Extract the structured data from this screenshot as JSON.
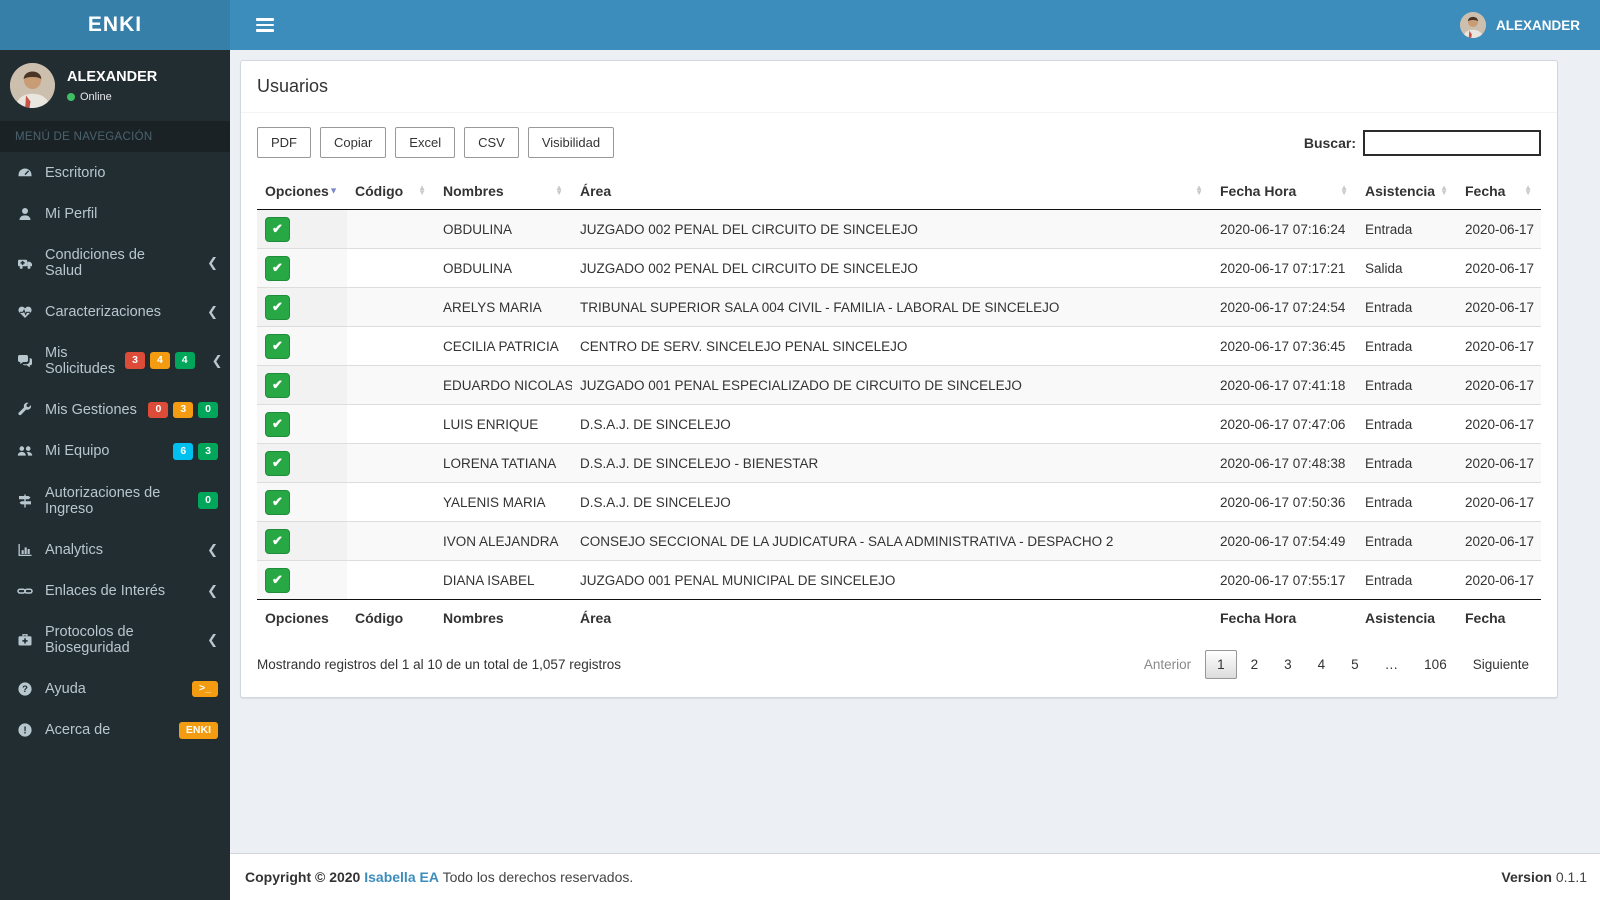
{
  "header": {
    "brand": "ENKI",
    "user_name": "ALEXANDER"
  },
  "sidebar": {
    "profile": {
      "name": "ALEXANDER",
      "status": "Online"
    },
    "nav_header": "MENÚ DE NAVEGACIÓN",
    "items": [
      {
        "icon": "dashboard-icon",
        "label": "Escritorio",
        "badges": [],
        "chevron": false
      },
      {
        "icon": "user-icon",
        "label": "Mi Perfil",
        "badges": [],
        "chevron": false
      },
      {
        "icon": "ambulance-icon",
        "label": "Condiciones de Salud",
        "badges": [],
        "chevron": true
      },
      {
        "icon": "heartbeat-icon",
        "label": "Caracterizaciones",
        "badges": [],
        "chevron": true
      },
      {
        "icon": "comments-icon",
        "label": "Mis Solicitudes",
        "badges": [
          {
            "text": "3",
            "color": "red"
          },
          {
            "text": "4",
            "color": "orange"
          },
          {
            "text": "4",
            "color": "green"
          }
        ],
        "chevron": true
      },
      {
        "icon": "wrench-icon",
        "label": "Mis Gestiones",
        "badges": [
          {
            "text": "0",
            "color": "red"
          },
          {
            "text": "3",
            "color": "orange"
          },
          {
            "text": "0",
            "color": "green"
          }
        ],
        "chevron": false
      },
      {
        "icon": "users-icon",
        "label": "Mi Equipo",
        "badges": [
          {
            "text": "6",
            "color": "cyan"
          },
          {
            "text": "3",
            "color": "green"
          }
        ],
        "chevron": false
      },
      {
        "icon": "map-signs-icon",
        "label": "Autorizaciones de Ingreso",
        "badges": [
          {
            "text": "0",
            "color": "green"
          }
        ],
        "chevron": false
      },
      {
        "icon": "bar-chart-icon",
        "label": "Analytics",
        "badges": [],
        "chevron": true
      },
      {
        "icon": "link-icon",
        "label": "Enlaces de Interés",
        "badges": [],
        "chevron": true
      },
      {
        "icon": "medkit-icon",
        "label": "Protocolos de Bioseguridad",
        "badges": [],
        "chevron": true
      },
      {
        "icon": "question-icon",
        "label": "Ayuda",
        "badges": [
          {
            "text": ">_",
            "color": "orange"
          }
        ],
        "chevron": false
      },
      {
        "icon": "info-icon",
        "label": "Acerca de",
        "badges": [
          {
            "text": "ENKI",
            "color": "orange"
          }
        ],
        "chevron": false
      }
    ]
  },
  "main": {
    "title": "Usuarios",
    "toolbar": {
      "buttons": [
        "PDF",
        "Copiar",
        "Excel",
        "CSV",
        "Visibilidad"
      ],
      "search_label": "Buscar:",
      "search_value": ""
    },
    "table": {
      "columns": [
        "Opciones",
        "Código",
        "Nombres",
        "Área",
        "Fecha Hora",
        "Asistencia",
        "Fecha"
      ],
      "sorted_column": "Opciones",
      "sort_direction": "desc",
      "check_icon": "✔",
      "rows": [
        {
          "codigo": "",
          "nombres": "OBDULINA",
          "area": "JUZGADO 002 PENAL DEL CIRCUITO DE SINCELEJO",
          "fecha_hora": "2020-06-17 07:16:24",
          "asistencia": "Entrada",
          "fecha": "2020-06-17"
        },
        {
          "codigo": "",
          "nombres": "OBDULINA",
          "area": "JUZGADO 002 PENAL DEL CIRCUITO DE SINCELEJO",
          "fecha_hora": "2020-06-17 07:17:21",
          "asistencia": "Salida",
          "fecha": "2020-06-17"
        },
        {
          "codigo": "",
          "nombres": "ARELYS MARIA",
          "area": "TRIBUNAL SUPERIOR SALA 004 CIVIL - FAMILIA - LABORAL DE SINCELEJO",
          "fecha_hora": "2020-06-17 07:24:54",
          "asistencia": "Entrada",
          "fecha": "2020-06-17"
        },
        {
          "codigo": "",
          "nombres": "CECILIA PATRICIA",
          "area": "CENTRO DE SERV. SINCELEJO PENAL SINCELEJO",
          "fecha_hora": "2020-06-17 07:36:45",
          "asistencia": "Entrada",
          "fecha": "2020-06-17"
        },
        {
          "codigo": "",
          "nombres": "EDUARDO NICOLAS",
          "area": "JUZGADO 001 PENAL ESPECIALIZADO DE CIRCUITO DE SINCELEJO",
          "fecha_hora": "2020-06-17 07:41:18",
          "asistencia": "Entrada",
          "fecha": "2020-06-17"
        },
        {
          "codigo": "",
          "nombres": "LUIS ENRIQUE",
          "area": "D.S.A.J. DE SINCELEJO",
          "fecha_hora": "2020-06-17 07:47:06",
          "asistencia": "Entrada",
          "fecha": "2020-06-17"
        },
        {
          "codigo": "",
          "nombres": "LORENA TATIANA",
          "area": "D.S.A.J. DE SINCELEJO - BIENESTAR",
          "fecha_hora": "2020-06-17 07:48:38",
          "asistencia": "Entrada",
          "fecha": "2020-06-17"
        },
        {
          "codigo": "",
          "nombres": "YALENIS MARIA",
          "area": "D.S.A.J. DE SINCELEJO",
          "fecha_hora": "2020-06-17 07:50:36",
          "asistencia": "Entrada",
          "fecha": "2020-06-17"
        },
        {
          "codigo": "",
          "nombres": "IVON ALEJANDRA",
          "area": "CONSEJO SECCIONAL DE LA JUDICATURA - SALA ADMINISTRATIVA - DESPACHO 2",
          "fecha_hora": "2020-06-17 07:54:49",
          "asistencia": "Entrada",
          "fecha": "2020-06-17"
        },
        {
          "codigo": "",
          "nombres": "DIANA ISABEL",
          "area": "JUZGADO 001 PENAL MUNICIPAL DE SINCELEJO",
          "fecha_hora": "2020-06-17 07:55:17",
          "asistencia": "Entrada",
          "fecha": "2020-06-17"
        }
      ]
    },
    "info": "Mostrando registros del 1 al 10 de un total de 1,057 registros",
    "pagination": {
      "prev": "Anterior",
      "pages": [
        "1",
        "2",
        "3",
        "4",
        "5",
        "…",
        "106"
      ],
      "current": "1",
      "next": "Siguiente"
    }
  },
  "footer": {
    "copyright_bold": "Copyright © 2020",
    "brand_link": "Isabella EA",
    "copyright_rest": "Todo los derechos reservados.",
    "version_label": "Version",
    "version_value": "0.1.1"
  },
  "colors": {
    "navbar": "#3c8dbc",
    "logo_bg": "#367fa9",
    "sidebar_bg": "#222d32",
    "sidebar_text": "#b8c7ce",
    "check_green": "#28a745",
    "badge_red": "#dd4b39",
    "badge_orange": "#f39c12",
    "badge_green": "#00a65a",
    "badge_cyan": "#00c0ef",
    "link_blue": "#3c8dbc",
    "page_bg": "#ecf0f5"
  }
}
